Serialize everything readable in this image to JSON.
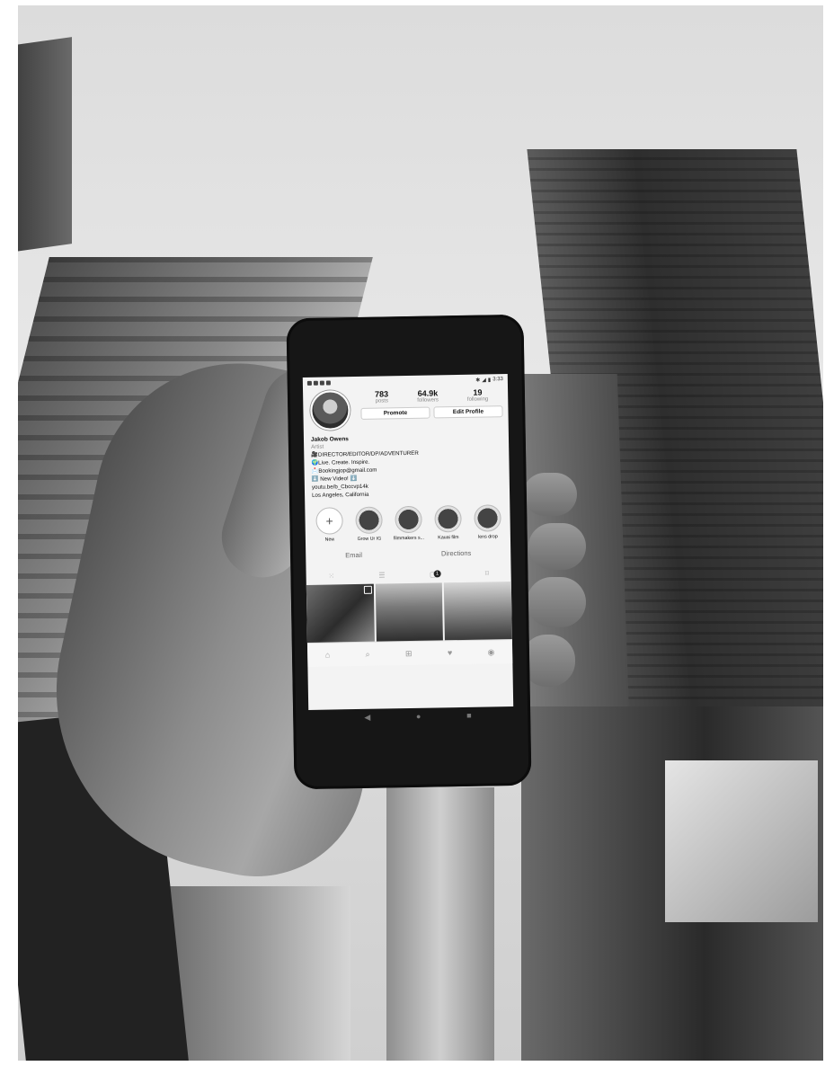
{
  "phone": {
    "status_time": "3:33",
    "profile": {
      "posts_count": "783",
      "posts_label": "posts",
      "followers_count": "64.9k",
      "followers_label": "followers",
      "following_count": "19",
      "following_label": "following",
      "promote_label": "Promote",
      "edit_profile_label": "Edit Profile",
      "name": "Jakob Owens",
      "category": "Artist",
      "bio_lines": [
        "🎥DIRECTOR/EDITOR/DP/ADVENTURER",
        "🌍Live. Create. Inspire.",
        "📩Bookingjop@gmail.com",
        "⬇️ New Video! ⬇️",
        "youtu.be/b_Cbccvp14k",
        "Los Angeles, California"
      ]
    },
    "highlights": [
      {
        "label": "New",
        "icon": "plus-icon"
      },
      {
        "label": "Grow Ur IG"
      },
      {
        "label": "filmmakers s..."
      },
      {
        "label": "Kauai film"
      },
      {
        "label": "lens drop"
      }
    ],
    "actions": {
      "email": "Email",
      "directions": "Directions"
    },
    "tabs": {
      "tagged_badge": "1",
      "icons": [
        "grid-icon",
        "list-icon",
        "tagged-icon",
        "saved-icon"
      ]
    },
    "bottom_nav": [
      "home-icon",
      "search-icon",
      "add-icon",
      "heart-icon",
      "profile-icon"
    ],
    "system_nav": [
      "back-icon",
      "home-circle-icon",
      "recents-icon"
    ]
  }
}
